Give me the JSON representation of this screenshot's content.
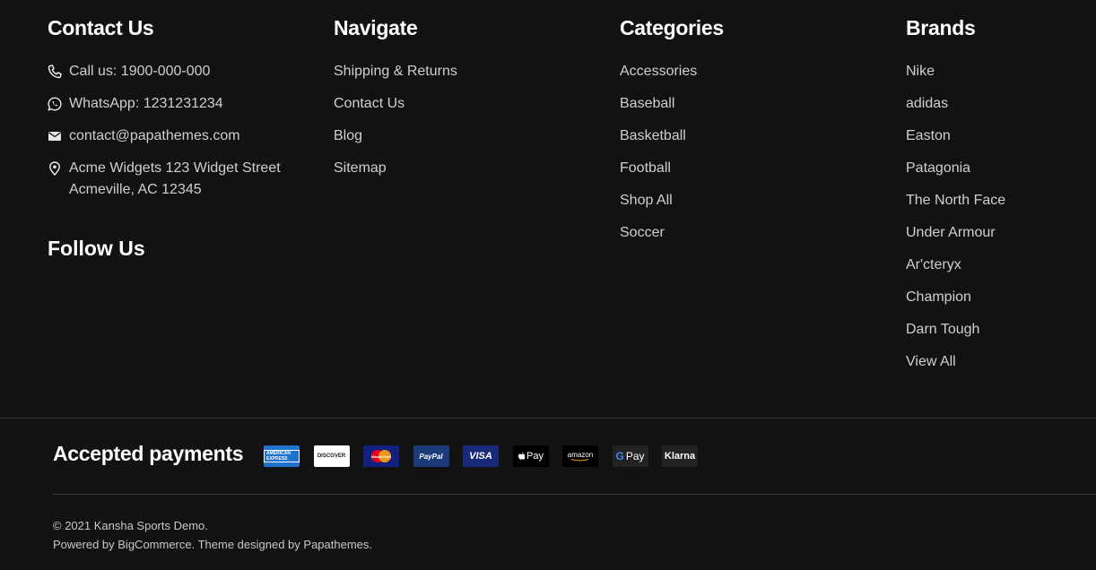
{
  "contact": {
    "title": "Contact Us",
    "phone": "Call us: 1900-000-000",
    "whatsapp": "WhatsApp: 1231231234",
    "email": "contact@papathemes.com",
    "address_line1": "Acme Widgets 123 Widget Street",
    "address_line2": "Acmeville, AC 12345"
  },
  "follow": {
    "title": "Follow Us"
  },
  "navigate": {
    "title": "Navigate",
    "items": [
      "Shipping & Returns",
      "Contact Us",
      "Blog",
      "Sitemap"
    ]
  },
  "categories": {
    "title": "Categories",
    "items": [
      "Accessories",
      "Baseball",
      "Basketball",
      "Football",
      "Shop All",
      "Soccer"
    ]
  },
  "brands": {
    "title": "Brands",
    "items": [
      "Nike",
      "adidas",
      "Easton",
      "Patagonia",
      "The North Face",
      "Under Armour",
      "Ar'cteryx",
      "Champion",
      "Darn Tough",
      "View All"
    ]
  },
  "payments": {
    "title": "Accepted payments",
    "cards": {
      "amex": "AMERICAN EXPRESS",
      "discover": "DISCOVER",
      "mastercard": "MasterCard",
      "paypal": "PayPal",
      "visa": "VISA",
      "applepay": "Pay",
      "amazon": "amazon",
      "googlepay": "Pay",
      "klarna": "Klarna"
    }
  },
  "footer": {
    "copyright": "© 2021 Kansha Sports Demo.",
    "powered": "Powered by BigCommerce. Theme designed by Papathemes."
  },
  "colors": {
    "background": "#121212",
    "heading": "#ffffff",
    "text": "#cfcfcf"
  }
}
